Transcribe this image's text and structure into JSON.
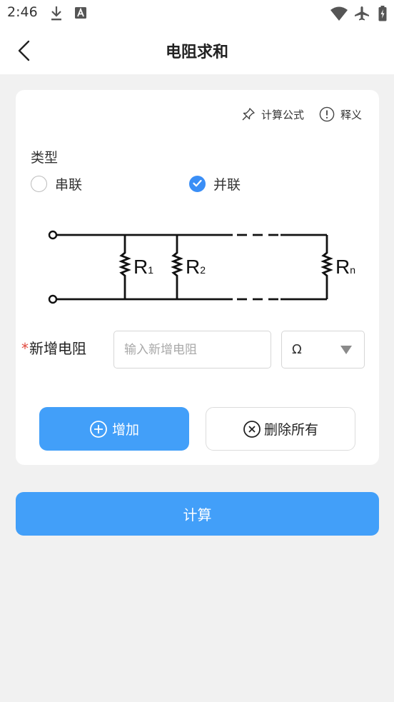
{
  "status_bar": {
    "time": "2:46",
    "left_icons": [
      "download-icon",
      "a-box-icon"
    ],
    "right_icons": [
      "wifi-icon",
      "airplane-icon",
      "battery-icon"
    ]
  },
  "app_bar": {
    "title": "电阻求和",
    "back_icon": "chevron-left-icon"
  },
  "tools": {
    "formula_label": "计算公式",
    "formula_icon": "pin-icon",
    "explain_label": "释义",
    "explain_icon": "info-circle-icon"
  },
  "type_section": {
    "label": "类型",
    "options": [
      {
        "label": "串联",
        "selected": false
      },
      {
        "label": "并联",
        "selected": true
      }
    ]
  },
  "diagram": {
    "labels": [
      {
        "main": "R",
        "sub": "1"
      },
      {
        "main": "R",
        "sub": "2"
      },
      {
        "main": "R",
        "sub": "n"
      }
    ]
  },
  "new_resistor": {
    "required_mark": "*",
    "label": "新增电阻",
    "placeholder": "输入新增电阻",
    "value": "",
    "unit": "Ω"
  },
  "actions": {
    "add_label": "增加",
    "add_icon": "plus-circle-icon",
    "clear_label": "删除所有",
    "clear_icon": "close-circle-icon",
    "calculate_label": "计算"
  },
  "colors": {
    "accent": "#429ff9",
    "radio_checked": "#3a8ef6",
    "required": "#e0483d",
    "background": "#f1f1f1"
  }
}
